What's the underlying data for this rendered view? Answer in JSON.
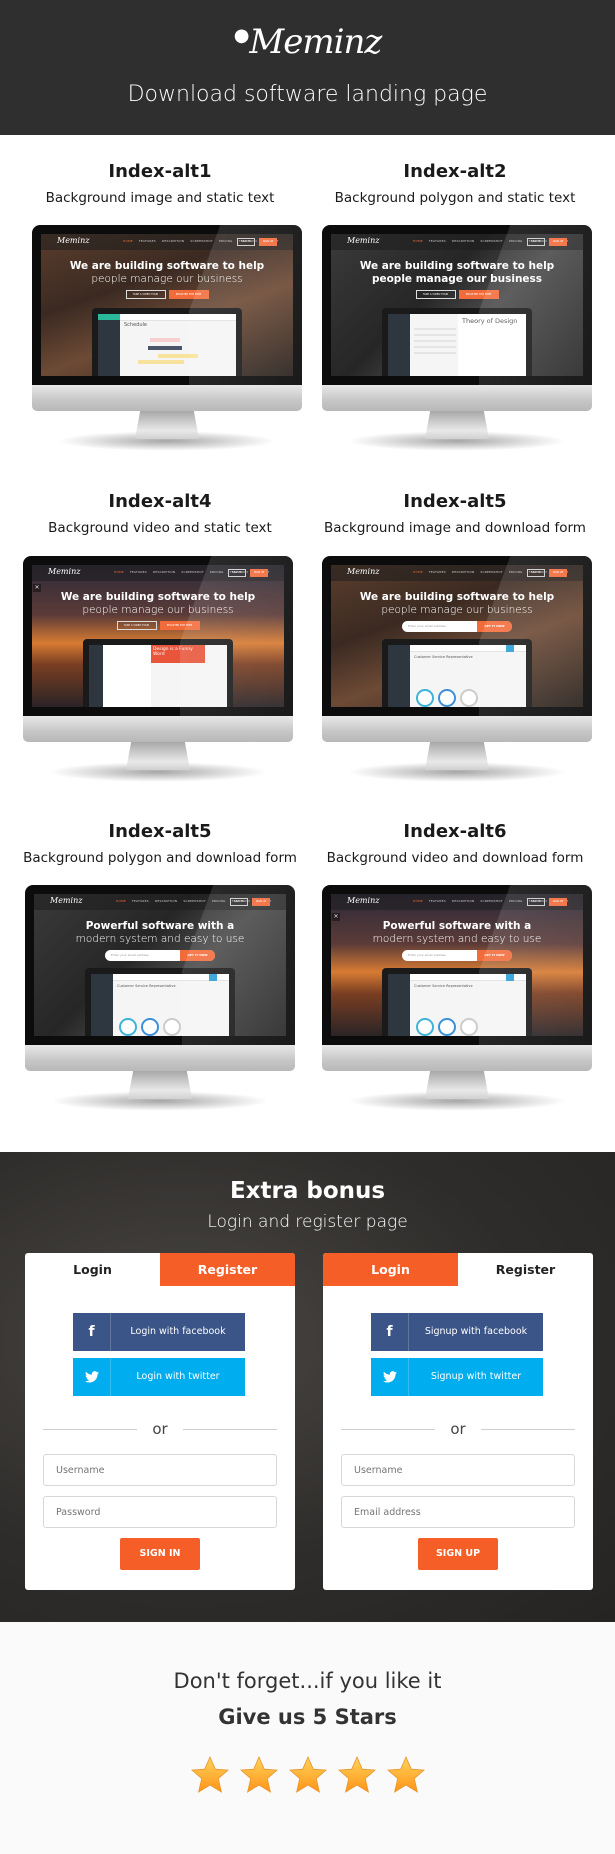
{
  "header": {
    "logo": "Meminz",
    "subtitle": "Download software landing page"
  },
  "screen_common": {
    "logo": "Meminz",
    "nav": [
      "HOME",
      "FEATURES",
      "DESCRIPTION",
      "SCREENSHOT",
      "PRICING",
      "TESTIMONI",
      "CONTACT"
    ],
    "sign_in": "SIGN IN",
    "sign_up": "SIGN UP",
    "tour_button": "TAKE A VIDEO TOUR",
    "register_button": "REGISTER FOR FREE",
    "email_placeholder": "Enter your email address",
    "get_button": "GET IT NOW",
    "close_icon": "close-icon"
  },
  "demos": [
    {
      "title": "Index-alt1",
      "subtitle": "Background image and static text",
      "headline1": "We are building software to help",
      "headline2": "people manage our business",
      "app_title": "Schedule"
    },
    {
      "title": "Index-alt2",
      "subtitle": "Background polygon and static text",
      "headline1": "We are building software to help",
      "headline2": "people manage our business",
      "app_title": "Theory of Design"
    },
    {
      "title": "Index-alt4",
      "subtitle": "Background video and static text",
      "headline1": "We are building software to help",
      "headline2": "people manage our business",
      "app_title": "Design is a Funny Word"
    },
    {
      "title": "Index-alt5",
      "subtitle": "Background image and download form",
      "headline1": "We are building software to help",
      "headline2": "people manage our business",
      "app_title": "Customer Service Representative"
    },
    {
      "title": "Index-alt5",
      "subtitle": "Background polygon and download form",
      "headline1": "Powerful software with a",
      "headline2": "modern system and easy to use",
      "app_title": "Customer Service Representative"
    },
    {
      "title": "Index-alt6",
      "subtitle": "Background video and download form",
      "headline1": "Powerful software with a",
      "headline2": "modern system and easy to use",
      "app_title": "Customer Service Representative"
    }
  ],
  "bonus": {
    "title": "Extra bonus",
    "subtitle": "Login and register page",
    "login_card": {
      "tab_login": "Login",
      "tab_register": "Register",
      "active_tab": "Login",
      "facebook": "Login with facebook",
      "twitter": "Login with twitter",
      "or": "or",
      "field1_placeholder": "Username",
      "field2_placeholder": "Password",
      "submit": "SIGN IN"
    },
    "register_card": {
      "tab_login": "Login",
      "tab_register": "Register",
      "active_tab": "Register",
      "facebook": "Signup with facebook",
      "twitter": "Signup with twitter",
      "or": "or",
      "field1_placeholder": "Username",
      "field2_placeholder": "Email address",
      "submit": "SIGN UP"
    }
  },
  "rating": {
    "line1": "Don't forget...if you like it",
    "line2": "Give us 5 Stars",
    "stars": 5
  },
  "colors": {
    "header_bg": "#2f2f2f",
    "accent_orange": "#f55e26",
    "facebook_blue": "#3b5589",
    "twitter_blue": "#00adee",
    "star_gold": "#ffb020"
  }
}
